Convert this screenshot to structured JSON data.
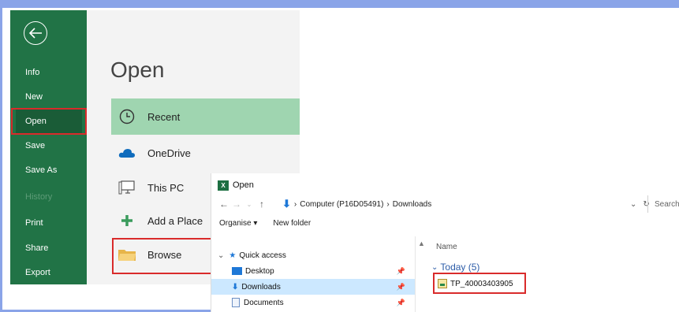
{
  "backstage": {
    "nav": [
      {
        "label": "Info"
      },
      {
        "label": "New"
      },
      {
        "label": "Open"
      },
      {
        "label": "Save"
      },
      {
        "label": "Save As"
      },
      {
        "label": "History"
      },
      {
        "label": "Print"
      },
      {
        "label": "Share"
      },
      {
        "label": "Export"
      }
    ],
    "title": "Open",
    "locations": [
      {
        "label": "Recent",
        "icon": "clock-icon"
      },
      {
        "label": "OneDrive",
        "icon": "cloud-icon"
      },
      {
        "label": "This PC",
        "icon": "computer-icon"
      },
      {
        "label": "Add a Place",
        "icon": "plus-icon"
      },
      {
        "label": "Browse",
        "icon": "folder-icon"
      }
    ]
  },
  "dialog": {
    "title": "Open",
    "breadcrumb": {
      "computer": "Computer (P16D05491)",
      "sep": "›",
      "folder": "Downloads"
    },
    "search_placeholder": "Search D",
    "toolbar": {
      "organise": "Organise ▾",
      "new_folder": "New folder"
    },
    "tree": [
      {
        "label": "Quick access",
        "icon": "star-icon"
      },
      {
        "label": "Desktop",
        "icon": "desktop-icon"
      },
      {
        "label": "Downloads",
        "icon": "download-icon"
      },
      {
        "label": "Documents",
        "icon": "document-icon"
      }
    ],
    "column_name": "Name",
    "group": "Today (5)",
    "files": [
      {
        "name": "TP_40003403905"
      }
    ]
  },
  "colors": {
    "excel_green": "#217346",
    "selected_green": "#9fd5b0",
    "highlight_red": "#d92b2b"
  }
}
